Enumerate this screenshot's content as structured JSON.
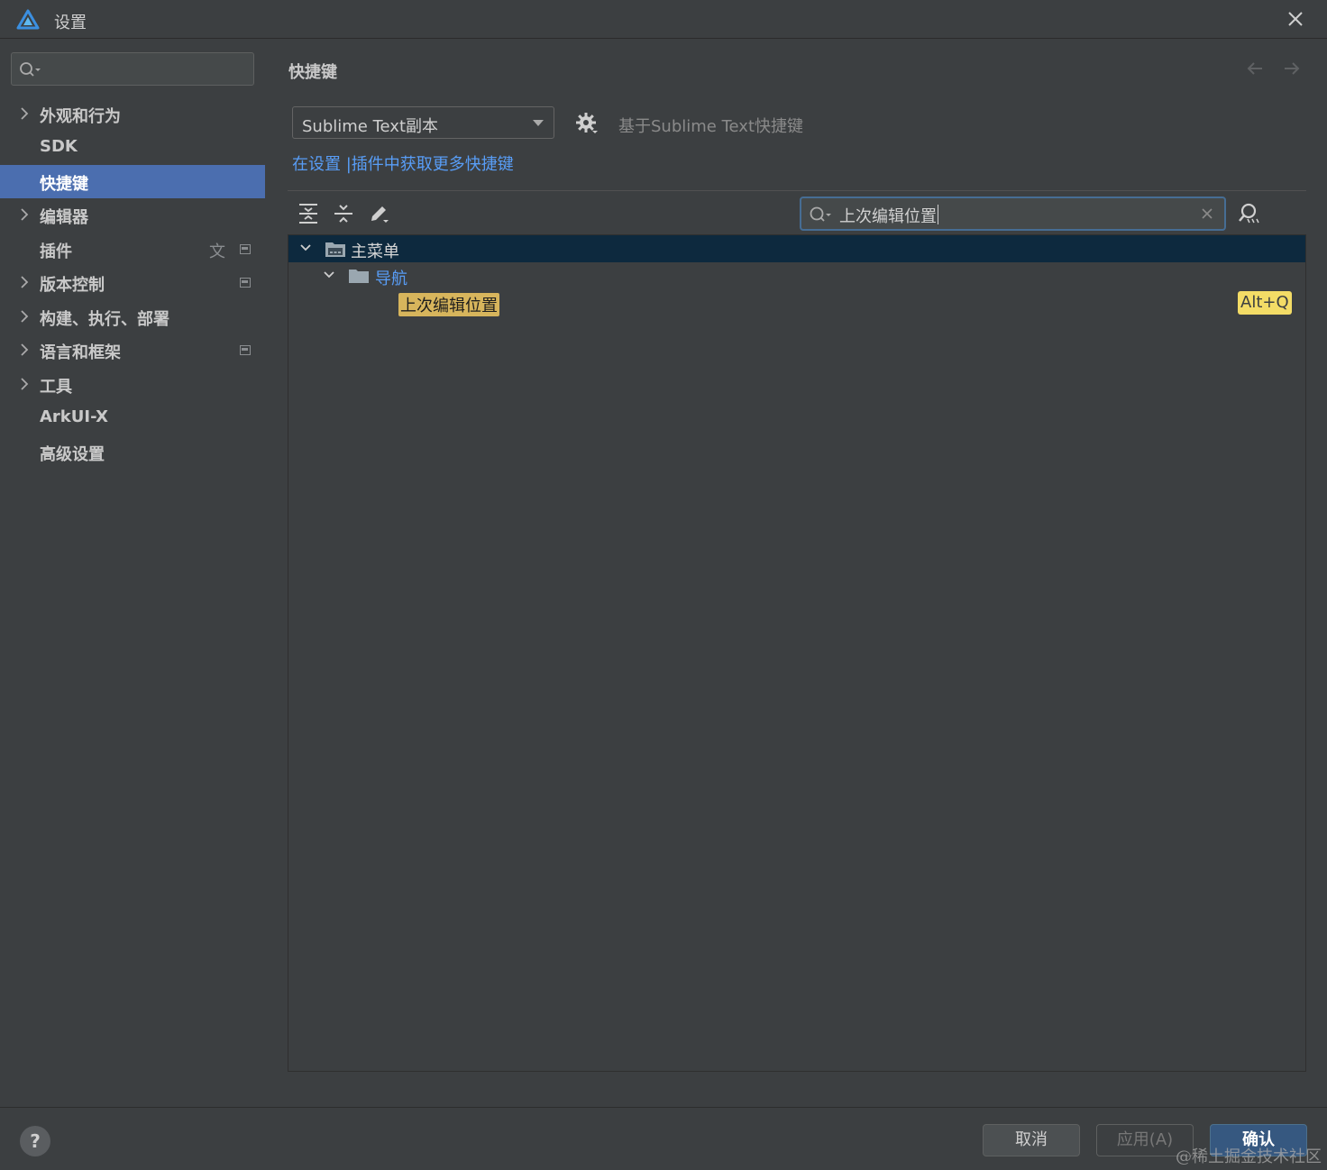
{
  "window": {
    "title": "设置"
  },
  "sidebar": {
    "search_placeholder": "",
    "items": [
      {
        "label": "外观和行为",
        "expandable": true,
        "badge": false
      },
      {
        "label": "SDK",
        "expandable": false,
        "badge": false
      },
      {
        "label": "快捷键",
        "expandable": false,
        "badge": false,
        "selected": true
      },
      {
        "label": "编辑器",
        "expandable": true,
        "badge": false
      },
      {
        "label": "插件",
        "expandable": false,
        "badge": true,
        "translate_icon": true
      },
      {
        "label": "版本控制",
        "expandable": true,
        "badge": true
      },
      {
        "label": "构建、执行、部署",
        "expandable": true,
        "badge": false
      },
      {
        "label": "语言和框架",
        "expandable": true,
        "badge": true
      },
      {
        "label": "工具",
        "expandable": true,
        "badge": false
      },
      {
        "label": "ArkUI-X",
        "expandable": false,
        "badge": false
      },
      {
        "label": "高级设置",
        "expandable": false,
        "badge": false
      }
    ]
  },
  "main": {
    "title": "快捷键",
    "keymap_selected": "Sublime Text副本",
    "based_on": "基于Sublime Text快捷键",
    "plugins_link": "在设置 |插件中获取更多快捷键",
    "search_value": "上次编辑位置",
    "tree": {
      "root": "主菜单",
      "group": "导航",
      "action": "上次编辑位置",
      "action_shortcut": "Alt+Q"
    }
  },
  "footer": {
    "help": "?",
    "cancel": "取消",
    "apply": "应用(A)",
    "ok": "确认",
    "watermark": "@稀土掘金技术社区"
  },
  "colors": {
    "background": "#3c3f41",
    "selection": "#4b6eaf",
    "tree_selection": "#0d293e",
    "link": "#589df6",
    "search_highlight": "#d7b55c",
    "shortcut_highlight": "#f3dc66",
    "primary_button": "#365880"
  },
  "icons": [
    "app-logo-icon",
    "close-icon",
    "search-icon",
    "chevron-right-icon",
    "translate-icon",
    "badge-icon",
    "back-arrow-icon",
    "forward-arrow-icon",
    "gear-icon",
    "expand-all-icon",
    "collapse-all-icon",
    "edit-icon",
    "clear-icon",
    "find-by-shortcut-icon",
    "chevron-down-icon",
    "folder-icon",
    "menu-folder-icon",
    "help-icon"
  ]
}
